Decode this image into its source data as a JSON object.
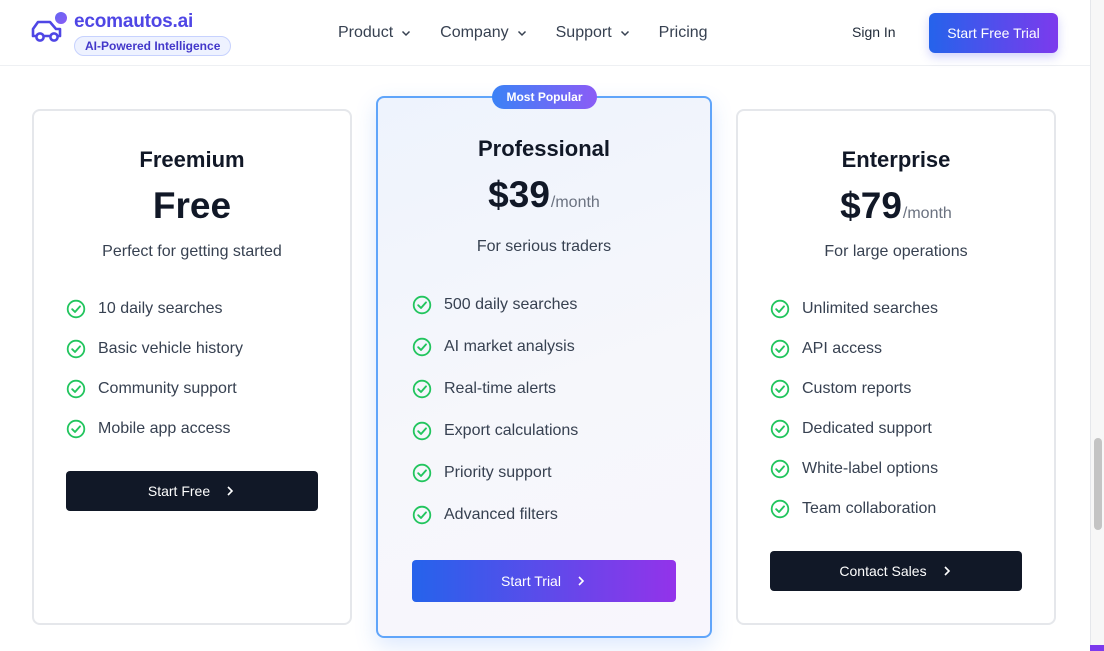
{
  "header": {
    "brand": "ecomautos.ai",
    "tagline": "AI-Powered Intelligence",
    "nav": [
      "Product",
      "Company",
      "Support",
      "Pricing"
    ],
    "sign_in": "Sign In",
    "cta": "Start Free Trial"
  },
  "plans": [
    {
      "name": "Freemium",
      "price": "Free",
      "period": "",
      "description": "Perfect for getting started",
      "features": [
        "10 daily searches",
        "Basic vehicle history",
        "Community support",
        "Mobile app access"
      ],
      "cta": "Start Free"
    },
    {
      "badge": "Most Popular",
      "name": "Professional",
      "price": "$39",
      "period": "/month",
      "description": "For serious traders",
      "features": [
        "500 daily searches",
        "AI market analysis",
        "Real-time alerts",
        "Export calculations",
        "Priority support",
        "Advanced filters"
      ],
      "cta": "Start Trial"
    },
    {
      "name": "Enterprise",
      "price": "$79",
      "period": "/month",
      "description": "For large operations",
      "features": [
        "Unlimited searches",
        "API access",
        "Custom reports",
        "Dedicated support",
        "White-label options",
        "Team collaboration"
      ],
      "cta": "Contact Sales"
    }
  ],
  "colors": {
    "brand": "#4f46e5",
    "check": "#22c55e",
    "dark_button": "#111827",
    "gradient_start": "#2563eb",
    "gradient_end": "#9333ea"
  },
  "icons": [
    "car-icon",
    "chevron-down-icon",
    "check-circle-icon",
    "chevron-right-icon"
  ]
}
